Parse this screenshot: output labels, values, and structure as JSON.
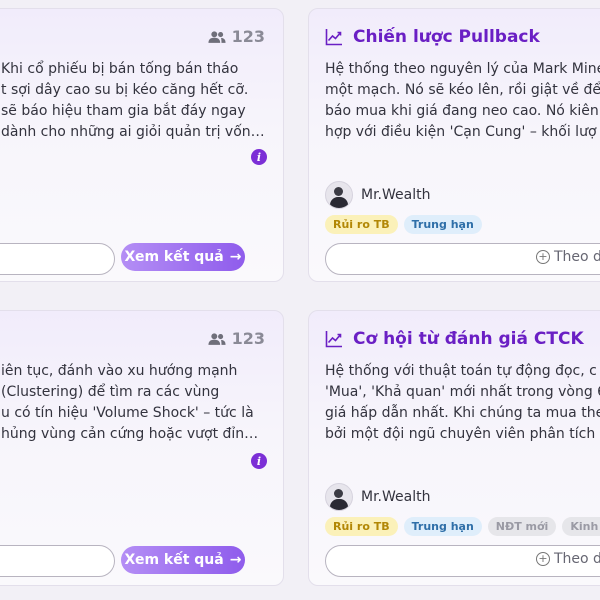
{
  "cards": [
    {
      "follower_count": "123",
      "description_lines": [
        "Khi cổ phiếu bị bán tống bán tháo",
        "t sợi dây cao su bị kéo căng hết cỡ.",
        "sẽ báo hiệu tham gia bắt đáy ngay",
        "dành cho những ai giỏi quản trị vốn…"
      ],
      "info_icon": "i",
      "result_label": "Xem kết quả",
      "arrow": "→"
    },
    {
      "title": "Chiến lược Pullback",
      "description_lines": [
        "Hệ thống theo nguyên lý của Mark Mine",
        "một mạch. Nó sẽ kéo lên, rồi giật về để",
        "báo mua khi giá đang neo cao. Nó kiên",
        "hợp với điều kiện 'Cạn Cung' – khối lượ"
      ],
      "author": "Mr.Wealth",
      "tags": [
        "Rủi ro TB",
        "Trung hạn"
      ],
      "follow_label": "Theo d"
    },
    {
      "follower_count": "123",
      "description_lines": [
        "iên tục, đánh vào xu hướng mạnh",
        "(Clustering) để tìm ra các vùng",
        "u có tín hiệu 'Volume Shock' – tức là",
        "hủng vùng cản cứng hoặc vượt đỉn…"
      ],
      "info_icon": "i",
      "result_label": "Xem kết quả",
      "arrow": "→"
    },
    {
      "title": "Cơ hội từ đánh giá CTCK",
      "description_lines": [
        "Hệ thống với thuật toán tự động đọc, c",
        "'Mua', 'Khả quan' mới nhất trong vòng 6",
        "giá hấp dẫn nhất. Khi chúng ta mua the",
        "bởi một đội ngũ chuyên viên phân tích"
      ],
      "author": "Mr.Wealth",
      "tags": [
        "Rủi ro TB",
        "Trung hạn",
        "NĐT mới",
        "Kinh ng"
      ],
      "follow_label": "Theo d"
    }
  ]
}
